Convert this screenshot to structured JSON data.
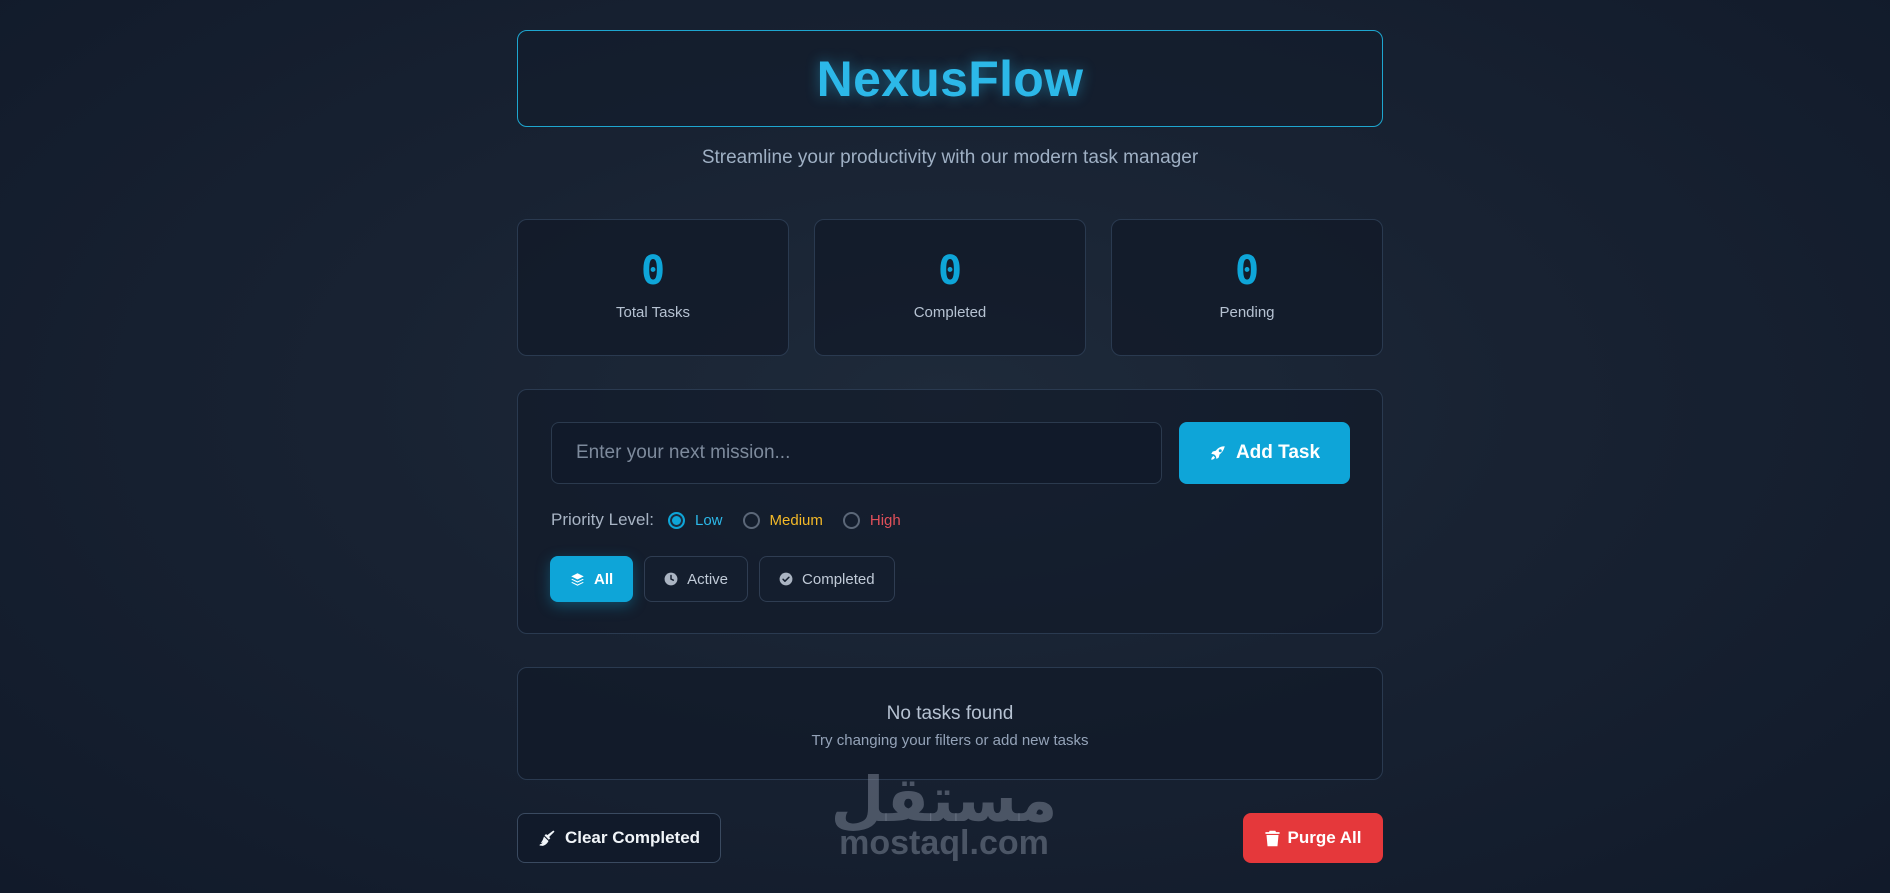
{
  "header": {
    "title": "NexusFlow",
    "subtitle": "Streamline your productivity with our modern task manager"
  },
  "stats": [
    {
      "value": "0",
      "label": "Total Tasks"
    },
    {
      "value": "0",
      "label": "Completed"
    },
    {
      "value": "0",
      "label": "Pending"
    }
  ],
  "task_form": {
    "input_value": "",
    "input_placeholder": "Enter your next mission...",
    "add_label": "Add Task",
    "add_icon": "rocket-icon",
    "priority_label": "Priority Level:",
    "priorities": [
      {
        "label": "Low",
        "color": "#2cb8e8",
        "selected": true
      },
      {
        "label": "Medium",
        "color": "#f3b928",
        "selected": false
      },
      {
        "label": "High",
        "color": "#e0505a",
        "selected": false
      }
    ]
  },
  "filters": [
    {
      "label": "All",
      "icon": "layers-icon",
      "active": true
    },
    {
      "label": "Active",
      "icon": "clock-icon",
      "active": false
    },
    {
      "label": "Completed",
      "icon": "check-circle-icon",
      "active": false
    }
  ],
  "empty_state": {
    "title": "No tasks found",
    "subtitle": "Try changing your filters or add new tasks"
  },
  "actions": {
    "clear_label": "Clear Completed",
    "clear_icon": "broom-icon",
    "purge_label": "Purge All",
    "purge_icon": "trash-icon"
  },
  "watermark": {
    "arabic": "مستقل",
    "latin": "mostaql.com"
  },
  "colors": {
    "accent": "#0ea5d8",
    "danger": "#e5383b",
    "background": "#182232"
  }
}
